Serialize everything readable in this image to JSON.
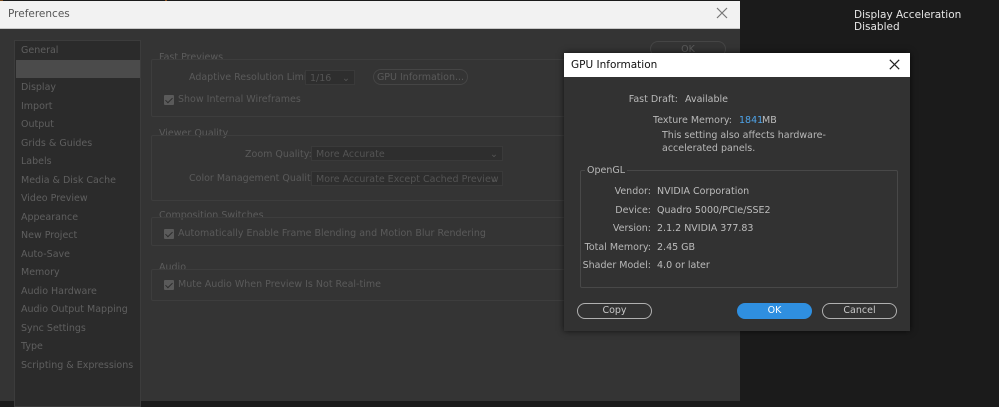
{
  "background": {
    "status_text": "Display Acceleration Disabled"
  },
  "preferences": {
    "title": "Preferences",
    "sidebar": [
      {
        "label": "General"
      },
      {
        "label": ""
      },
      {
        "label": "Display"
      },
      {
        "label": "Import"
      },
      {
        "label": "Output"
      },
      {
        "label": "Grids & Guides"
      },
      {
        "label": "Labels"
      },
      {
        "label": "Media & Disk Cache"
      },
      {
        "label": "Video Preview"
      },
      {
        "label": "Appearance"
      },
      {
        "label": "New Project"
      },
      {
        "label": "Auto-Save"
      },
      {
        "label": "Memory"
      },
      {
        "label": "Audio Hardware"
      },
      {
        "label": "Audio Output Mapping"
      },
      {
        "label": "Sync Settings"
      },
      {
        "label": "Type"
      },
      {
        "label": "Scripting & Expressions"
      }
    ],
    "ok_label": "OK",
    "fast_previews": {
      "section": "Fast Previews",
      "adaptive_label": "Adaptive Resolution Limit:",
      "adaptive_value": "1/16",
      "gpu_info_button": "GPU Information...",
      "wireframes_label": "Show Internal Wireframes"
    },
    "viewer_quality": {
      "section": "Viewer Quality",
      "zoom_label": "Zoom Quality:",
      "zoom_value": "More Accurate",
      "color_label": "Color Management Quality:",
      "color_value": "More Accurate Except Cached Preview"
    },
    "composition_switches": {
      "section": "Composition Switches",
      "auto_enable_label": "Automatically Enable Frame Blending and Motion Blur Rendering"
    },
    "audio": {
      "section": "Audio",
      "mute_label": "Mute Audio When Preview Is Not Real-time"
    }
  },
  "gpu_dialog": {
    "title": "GPU Information",
    "fast_draft_label": "Fast Draft:",
    "fast_draft_value": "Available",
    "texture_memory_label": "Texture Memory:",
    "texture_memory_value": "1841",
    "texture_memory_unit": "MB",
    "note": "This setting also affects hardware-accelerated panels.",
    "opengl_title": "OpenGL",
    "opengl": [
      {
        "label": "Vendor:",
        "value": "NVIDIA Corporation"
      },
      {
        "label": "Device:",
        "value": "Quadro 5000/PCIe/SSE2"
      },
      {
        "label": "Version:",
        "value": "2.1.2 NVIDIA 377.83"
      },
      {
        "label": "Total Memory:",
        "value": "2.45 GB"
      },
      {
        "label": "Shader Model:",
        "value": "4.0 or later"
      }
    ],
    "copy_button": "Copy",
    "ok_button": "OK",
    "cancel_button": "Cancel",
    "accent_color": "#2f8fe0"
  }
}
